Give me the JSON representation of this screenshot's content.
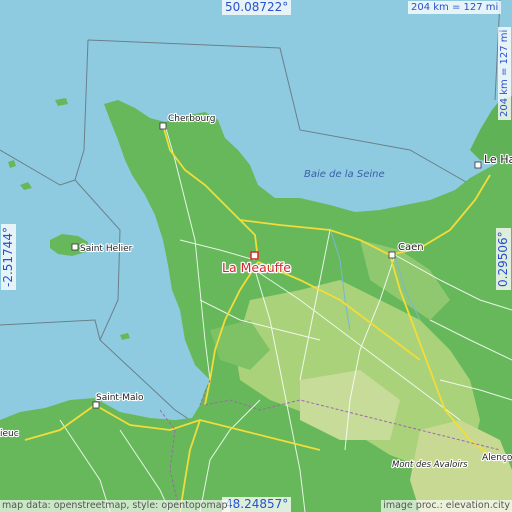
{
  "coordinates": {
    "top_latitude": "50.08722°",
    "bottom_latitude": "48.24857°",
    "left_longitude": "-2.51744°",
    "right_longitude": "0.29506°"
  },
  "scale": {
    "top": "204 km = 127 mi",
    "right": "204 km = 127 mi"
  },
  "places": {
    "main": "La Meauffe",
    "cherbourg": "Cherbourg",
    "saint_helier": "Saint Helier",
    "caen": "Caen",
    "le_havre": "Le Ha",
    "saint_malo": "Saint-Malo",
    "alencon": "Alenço",
    "dinan_partial": "ieuc",
    "mont_des_avaloirs": "Mont des Avaloirs"
  },
  "water": {
    "bay": "Baie de la Seine"
  },
  "credits": {
    "left": "map data: openstreetmap, style: opentopomap",
    "right": "image proc.: elevation.city"
  },
  "colors": {
    "sea": "#8fcbe0",
    "land_green": "#66b85a",
    "land_light": "#a9d27a",
    "marker": "#d6282f",
    "coord_text": "#2a4fcf"
  }
}
